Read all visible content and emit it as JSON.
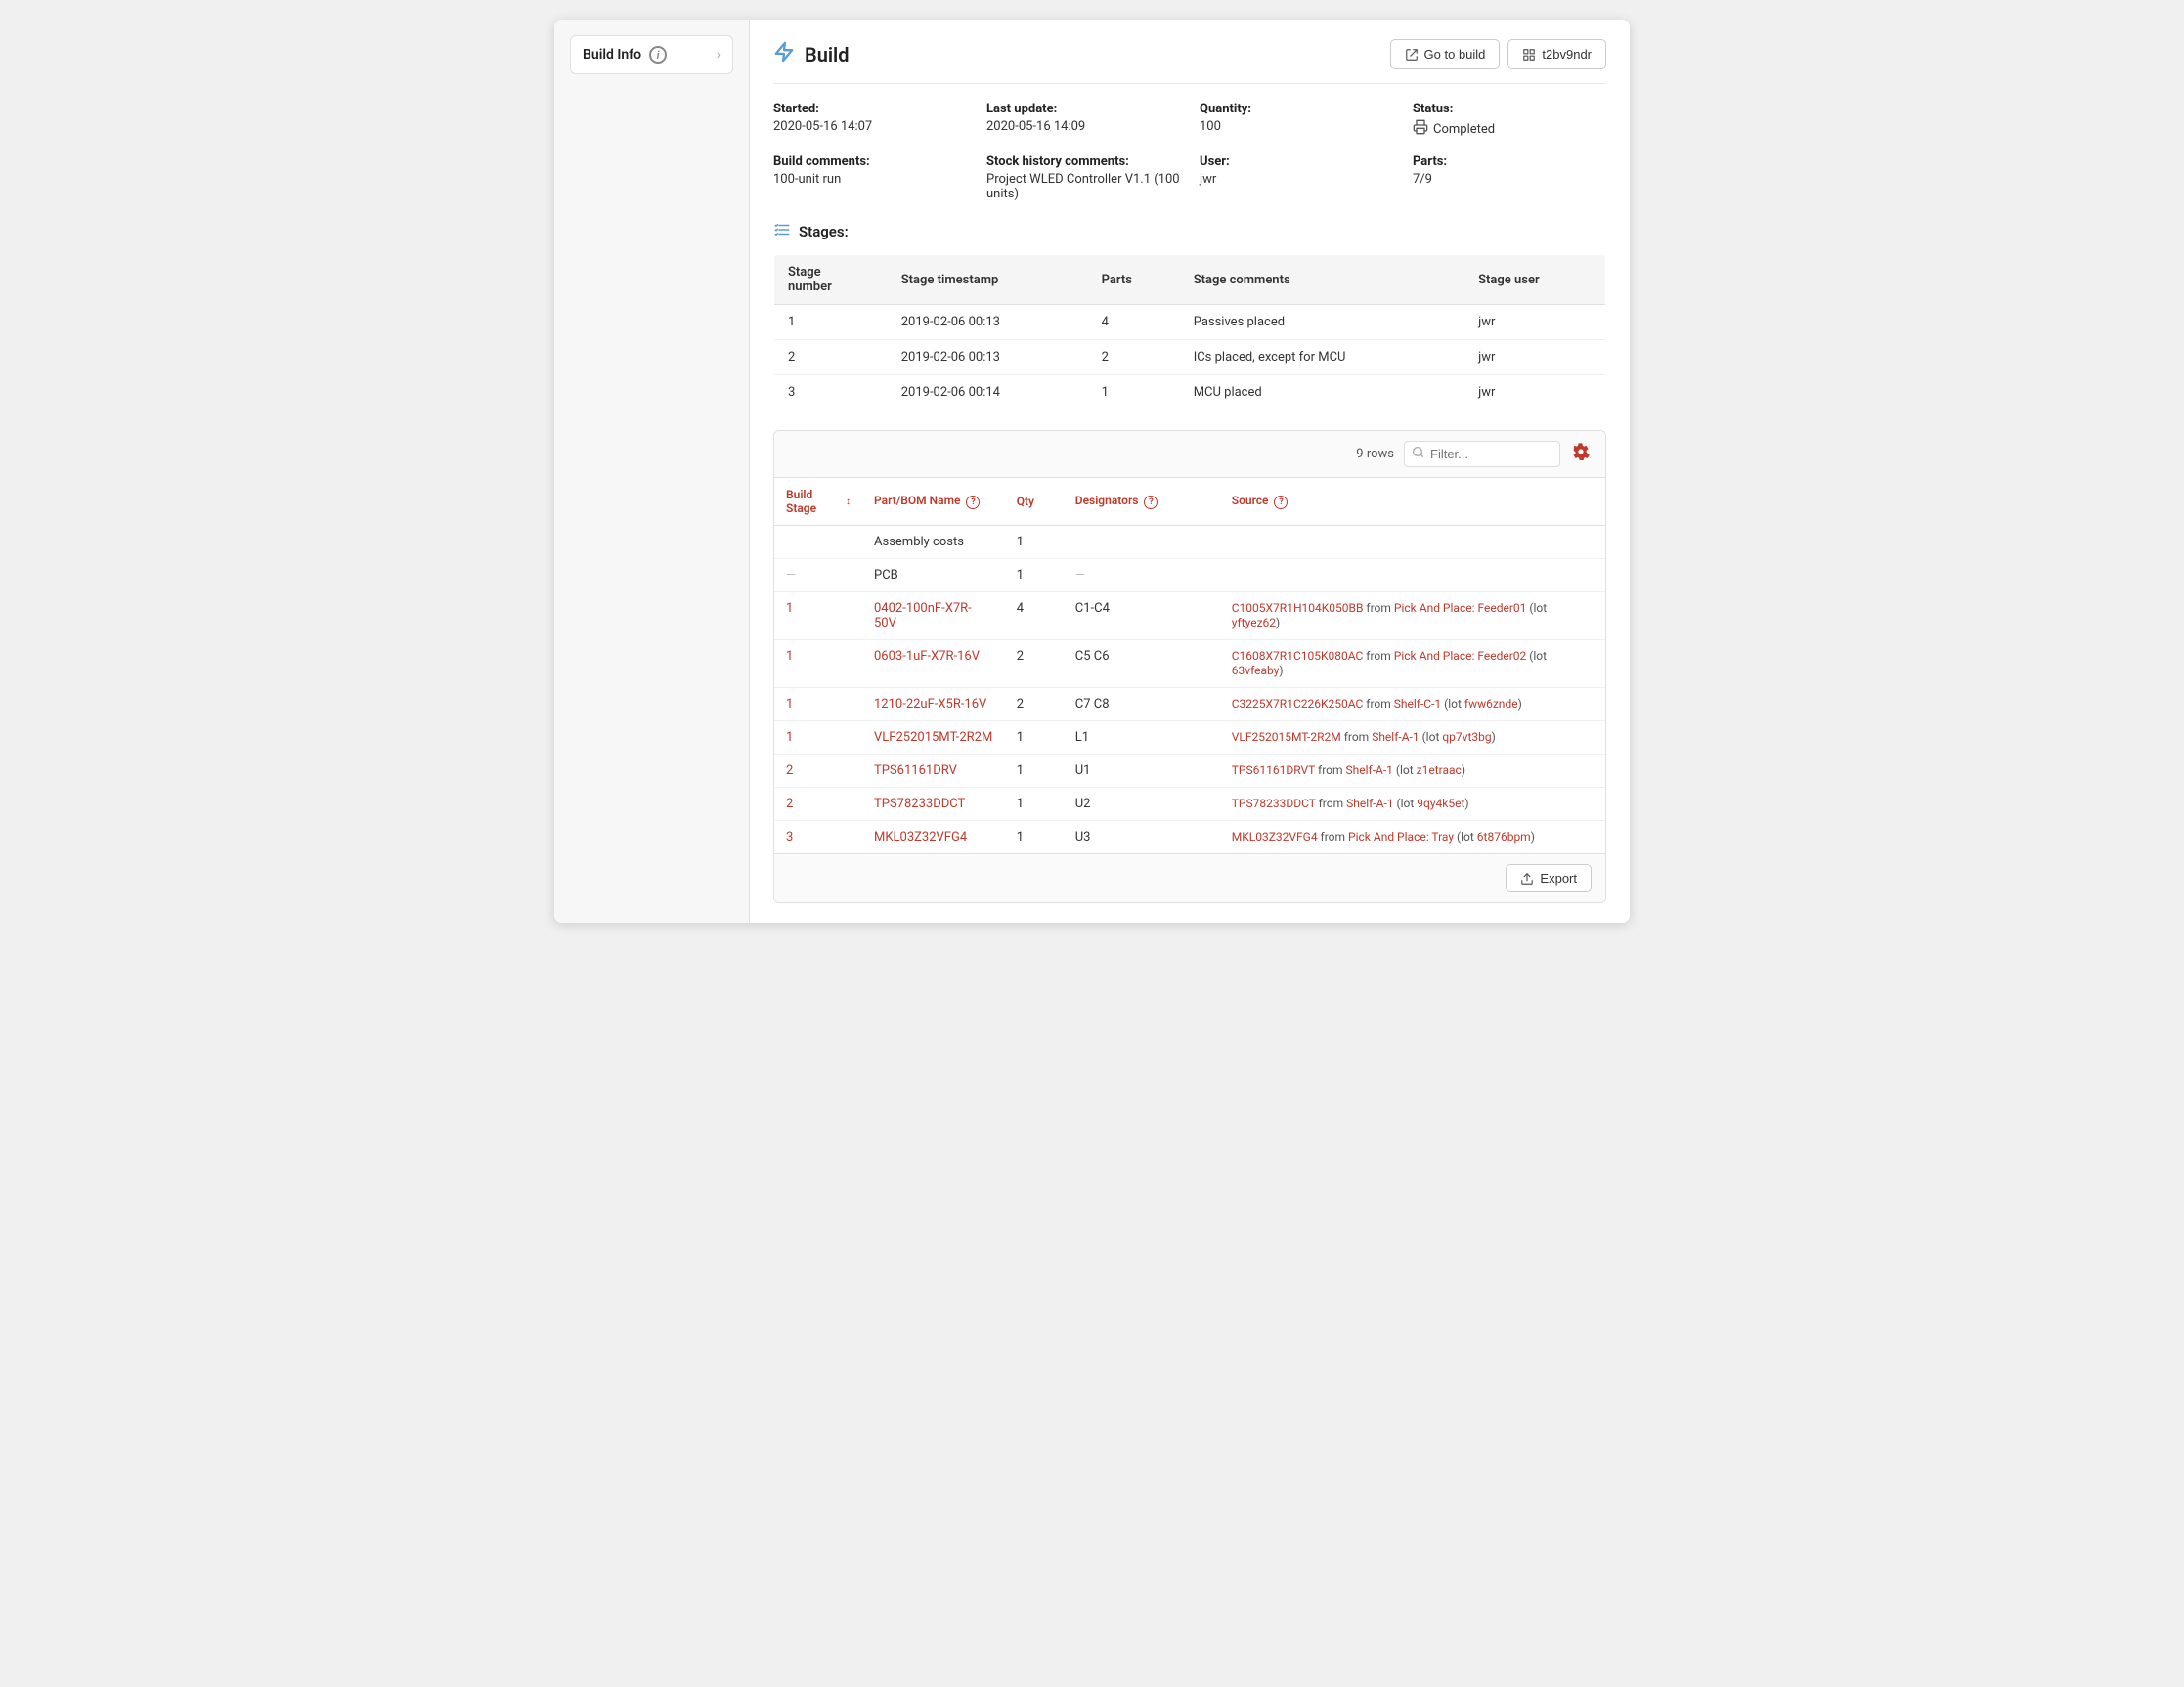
{
  "sidebar": {
    "item_label": "Build Info",
    "info_icon": "i",
    "chevron": "›"
  },
  "header": {
    "title": "Build",
    "bolt_icon": "⚡",
    "go_to_build_label": "Go to build",
    "build_id_label": "t2bv9ndr",
    "go_to_build_icon": "⇧",
    "grid_icon": "⊞"
  },
  "meta": {
    "started_label": "Started:",
    "started_value": "2020-05-16 14:07",
    "last_update_label": "Last update:",
    "last_update_value": "2020-05-16 14:09",
    "quantity_label": "Quantity:",
    "quantity_value": "100",
    "status_label": "Status:",
    "status_icon": "🖨",
    "status_value": "Completed",
    "build_comments_label": "Build comments:",
    "build_comments_value": "100-unit run",
    "stock_history_label": "Stock history comments:",
    "stock_history_value": "Project WLED Controller V1.1 (100 units)",
    "user_label": "User:",
    "user_value": "jwr",
    "parts_label": "Parts:",
    "parts_value": "7/9"
  },
  "stages_section": {
    "icon": "☰",
    "title": "Stages:",
    "columns": [
      "Stage number",
      "Stage timestamp",
      "Parts",
      "Stage comments",
      "Stage user"
    ],
    "rows": [
      {
        "stage_number": "1",
        "timestamp": "2019-02-06 00:13",
        "parts": "4",
        "comments": "Passives placed",
        "user": "jwr"
      },
      {
        "stage_number": "2",
        "timestamp": "2019-02-06 00:13",
        "parts": "2",
        "comments": "ICs placed, except for MCU",
        "user": "jwr"
      },
      {
        "stage_number": "3",
        "timestamp": "2019-02-06 00:14",
        "parts": "1",
        "comments": "MCU placed",
        "user": "jwr"
      }
    ]
  },
  "parts_section": {
    "rows_count": "9 rows",
    "filter_placeholder": "Filter...",
    "columns": {
      "build_stage": "Build Stage",
      "part_bom_name": "Part/BOM Name",
      "qty": "Qty",
      "designators": "Designators",
      "source": "Source"
    },
    "rows": [
      {
        "stage": "—",
        "part_name": "Assembly costs",
        "part_link": false,
        "qty": "1",
        "designators": "—",
        "source": ""
      },
      {
        "stage": "—",
        "part_name": "PCB",
        "part_link": false,
        "qty": "1",
        "designators": "—",
        "source": ""
      },
      {
        "stage": "1",
        "part_name": "0402-100nF-X7R-50V",
        "part_link": true,
        "qty": "4",
        "designators": "C1-C4",
        "source": "C1005X7R1H104K050BB from Pick And Place: Feeder01 (lot yftyez62)",
        "source_part": "C1005X7R1H104K050BB",
        "source_from": "from",
        "source_location": "Pick And Place: Feeder01",
        "source_lot_prefix": "(lot ",
        "source_lot": "yftyez62",
        "source_lot_suffix": ")"
      },
      {
        "stage": "1",
        "part_name": "0603-1uF-X7R-16V",
        "part_link": true,
        "qty": "2",
        "designators": "C5 C6",
        "source": "C1608X7R1C105K080AC from Pick And Place: Feeder02 (lot 63vfeaby)",
        "source_part": "C1608X7R1C105K080AC",
        "source_from": "from",
        "source_location": "Pick And Place: Feeder02",
        "source_lot_prefix": "(lot ",
        "source_lot": "63vfeaby",
        "source_lot_suffix": ")"
      },
      {
        "stage": "1",
        "part_name": "1210-22uF-X5R-16V",
        "part_link": true,
        "qty": "2",
        "designators": "C7 C8",
        "source": "C3225X7R1C226K250AC from Shelf-C-1 (lot fww6znde)",
        "source_part": "C3225X7R1C226K250AC",
        "source_from": "from",
        "source_location": "Shelf-C-1",
        "source_lot_prefix": "(lot ",
        "source_lot": "fww6znde",
        "source_lot_suffix": ")"
      },
      {
        "stage": "1",
        "part_name": "VLF252015MT-2R2M",
        "part_link": true,
        "qty": "1",
        "designators": "L1",
        "source": "VLF252015MT-2R2M from Shelf-A-1 (lot qp7vt3bg)",
        "source_part": "VLF252015MT-2R2M",
        "source_from": "from",
        "source_location": "Shelf-A-1",
        "source_lot_prefix": "(lot ",
        "source_lot": "qp7vt3bg",
        "source_lot_suffix": ")"
      },
      {
        "stage": "2",
        "part_name": "TPS61161DRV",
        "part_link": true,
        "qty": "1",
        "designators": "U1",
        "source": "TPS61161DRVT from Shelf-A-1 (lot z1etraac)",
        "source_part": "TPS61161DRVT",
        "source_from": "from",
        "source_location": "Shelf-A-1",
        "source_lot_prefix": "(lot ",
        "source_lot": "z1etraac",
        "source_lot_suffix": ")"
      },
      {
        "stage": "2",
        "part_name": "TPS78233DDCT",
        "part_link": true,
        "qty": "1",
        "designators": "U2",
        "source": "TPS78233DDCT from Shelf-A-1 (lot 9qy4k5et)",
        "source_part": "TPS78233DDCT",
        "source_from": "from",
        "source_location": "Shelf-A-1",
        "source_lot_prefix": "(lot ",
        "source_lot": "9qy4k5et",
        "source_lot_suffix": ")"
      },
      {
        "stage": "3",
        "part_name": "MKL03Z32VFG4",
        "part_link": true,
        "qty": "1",
        "designators": "U3",
        "source": "MKL03Z32VFG4 from Pick And Place: Tray (lot 6t876bpm)",
        "source_part": "MKL03Z32VFG4",
        "source_from": "from",
        "source_location": "Pick And Place: Tray",
        "source_lot_prefix": "(lot ",
        "source_lot": "6t876bpm",
        "source_lot_suffix": ")"
      }
    ],
    "export_label": "Export",
    "export_icon": "⬆"
  }
}
